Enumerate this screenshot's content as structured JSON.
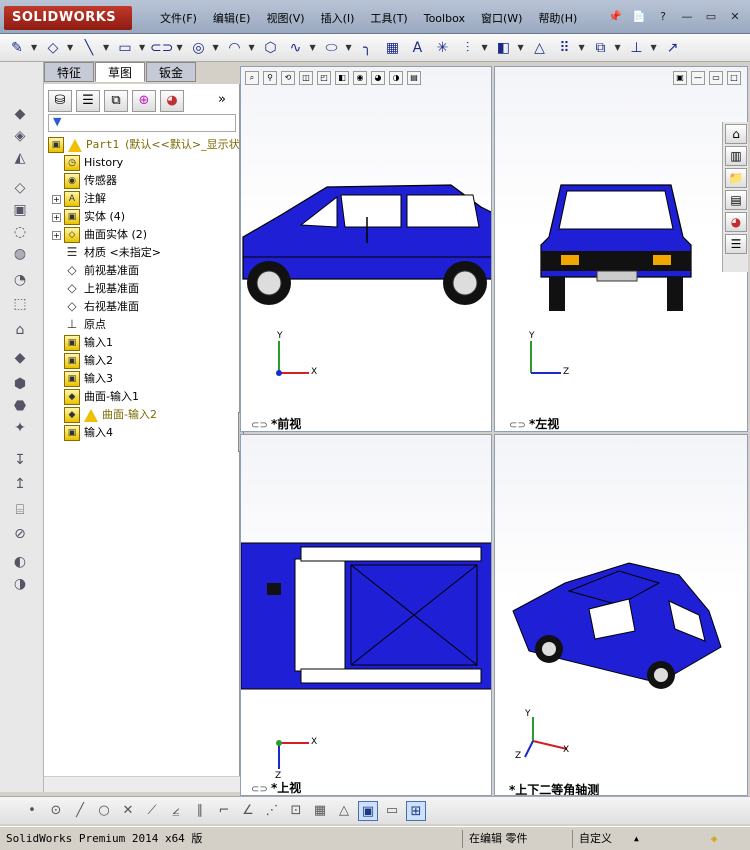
{
  "app": {
    "logo": "SOLIDWORKS"
  },
  "menu": [
    "文件(F)",
    "编辑(E)",
    "视图(V)",
    "插入(I)",
    "工具(T)",
    "Toolbox",
    "窗口(W)",
    "帮助(H)"
  ],
  "window_controls": {
    "help": "?",
    "minimize": "—",
    "restore": "▭",
    "close": "✕"
  },
  "tabs": [
    "特征",
    "草图",
    "钣金"
  ],
  "tree": {
    "root": "Part1",
    "root_suffix": "(默认<<默认>_显示状",
    "items": [
      {
        "label": "History",
        "icon": "history-icon"
      },
      {
        "label": "传感器",
        "icon": "sensor-icon"
      },
      {
        "label": "注解",
        "icon": "annotation-icon",
        "expand": true
      },
      {
        "label": "实体 (4)",
        "icon": "solid-body-icon",
        "expand": true
      },
      {
        "label": "曲面实体 (2)",
        "icon": "surface-body-icon",
        "expand": true
      },
      {
        "label": "材质 <未指定>",
        "icon": "material-icon"
      },
      {
        "label": "前视基准面",
        "icon": "plane-icon"
      },
      {
        "label": "上视基准面",
        "icon": "plane-icon"
      },
      {
        "label": "右视基准面",
        "icon": "plane-icon"
      },
      {
        "label": "原点",
        "icon": "origin-icon"
      },
      {
        "label": "输入1",
        "icon": "import-icon"
      },
      {
        "label": "输入2",
        "icon": "import-icon"
      },
      {
        "label": "输入3",
        "icon": "import-icon"
      },
      {
        "label": "曲面-输入1",
        "icon": "surface-import-icon"
      },
      {
        "label": "曲面-输入2",
        "icon": "surface-import-icon",
        "warning": true
      },
      {
        "label": "输入4",
        "icon": "import-icon"
      }
    ]
  },
  "viewports": {
    "front": "*前视",
    "left": "*左视",
    "top": "*上视",
    "iso": "*上下二等角轴测"
  },
  "axes": {
    "x": "X",
    "y": "Y",
    "z": "Z"
  },
  "status": {
    "product": "SolidWorks Premium 2014 x64 版",
    "mode": "在编辑 零件",
    "units": "自定义",
    "arrow": "▲"
  },
  "colors": {
    "car": "#1f1fd6",
    "accent": "#c0392b"
  }
}
